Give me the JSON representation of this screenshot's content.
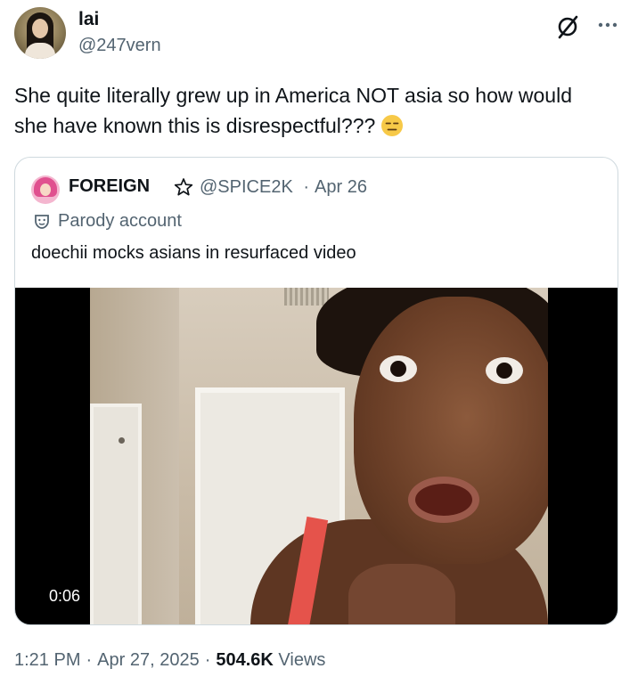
{
  "author": {
    "display_name": "lai",
    "handle": "@247vern",
    "avatar_icon": "profile-photo"
  },
  "actions": {
    "grok_icon": "grok-icon",
    "more_icon": "more-horizontal-icon"
  },
  "tweet": {
    "line1": "She quite literally grew up in America NOT asia so how would",
    "line2": "she have known this is disrespectful???",
    "emoji": "expressionless-face-emoji"
  },
  "quoted": {
    "display_name": "FOREIGN",
    "star_icon": "star-outline-icon",
    "handle": "@SPICE2K",
    "separator": "·",
    "date": "Apr 26",
    "parody_icon": "theater-mask-icon",
    "parody_label": "Parody account",
    "text": "doechii mocks asians in resurfaced video",
    "video": {
      "duration": "0:06"
    }
  },
  "footer": {
    "time": "1:21 PM",
    "separator": "·",
    "date": "Apr 27, 2025",
    "views_count": "504.6K",
    "views_label": "Views"
  },
  "colors": {
    "text_primary": "#0f1419",
    "text_secondary": "#536471",
    "border": "#cfd9de",
    "emoji_yellow": "#f7c948"
  }
}
